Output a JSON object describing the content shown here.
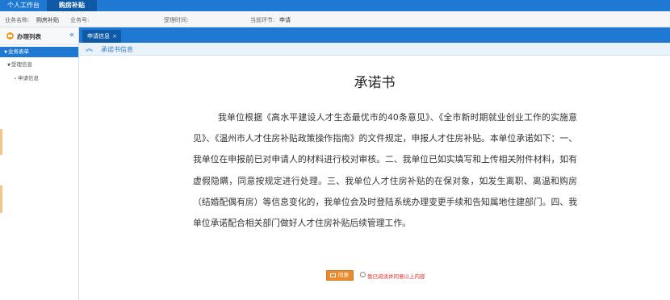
{
  "topbar": {
    "tabs": [
      {
        "label": "个人工作台"
      },
      {
        "label": "购房补贴"
      }
    ]
  },
  "info": {
    "business_name_label": "业务名称:",
    "business_name_value": "购房补贴",
    "business_no_label": "业务号:",
    "business_no_value": "",
    "accept_time_label": "受理时间:",
    "accept_time_value": "",
    "current_step_label": "当前环节:",
    "current_step_value": "申请"
  },
  "sidebar": {
    "title": "办理列表",
    "collapse_icon": "double-chevron-left",
    "items": [
      {
        "label": "业务表单",
        "level": 0,
        "active": true
      },
      {
        "label": "受理信息",
        "level": 1,
        "active": false
      },
      {
        "label": "申请信息",
        "level": 2,
        "active": false
      }
    ]
  },
  "content": {
    "tab_label": "申请信息",
    "section_label": "承诺书信息",
    "doc_title": "承诺书",
    "doc_body": "我单位根据《高水平建设人才生态最优市的40条意见》、《全市新时期就业创业工作的实施意见》、《温州市人才住房补贴政策操作指南》的文件规定，申报人才住房补贴。本单位承诺如下：一、我单位在申报前已对申请人的材料进行校对审核。二、我单位已如实填写和上传相关附件材料，如有虚假隐瞒，同意按规定进行处理。三、我单位人才住房补贴的在保对象，如发生离职、离温和购房（结婚配偶有房）等信息变化的，我单位会及时登陆系统办理变更手续和告知属地住建部门。四、我单位承诺配合相关部门做好人才住房补贴后续管理工作。",
    "agree_button": "同意",
    "agree_radio_label": "我已阅读并同意以上内容"
  },
  "colors": {
    "primary": "#1f78d1",
    "primary_dark": "#0f5aa6",
    "accent_orange": "#e98c2f",
    "alert_red": "#d9302a"
  }
}
